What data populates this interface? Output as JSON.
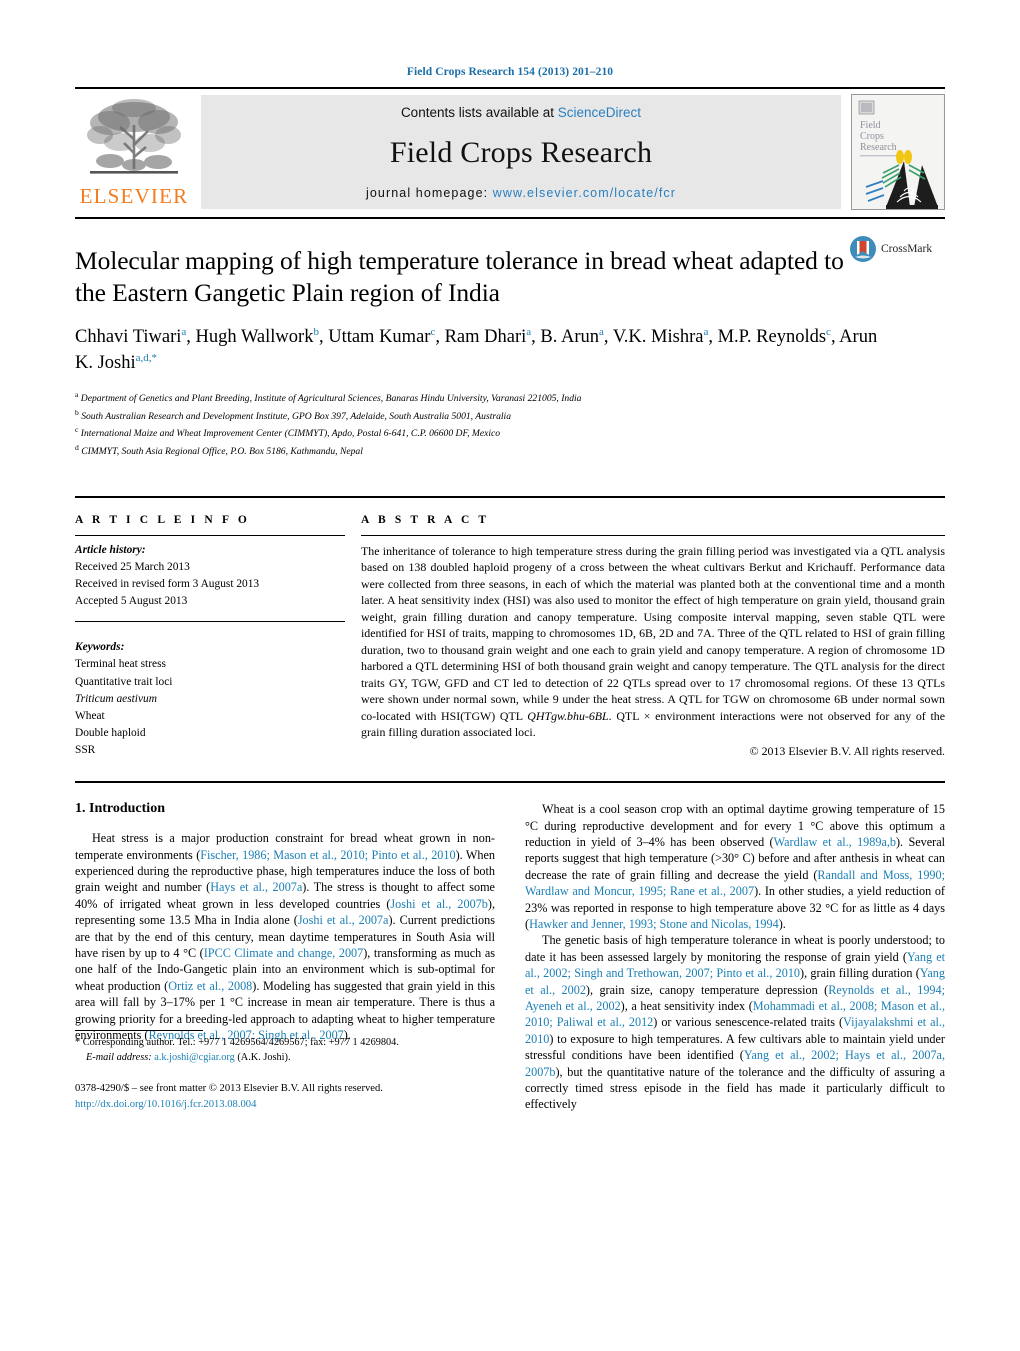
{
  "running_head": "Field Crops Research 154 (2013) 201–210",
  "masthead": {
    "publisher_name": "ELSEVIER",
    "contents_prefix": "Contents lists available at ",
    "contents_link": "ScienceDirect",
    "journal_title": "Field Crops Research",
    "homepage_label": "journal homepage:",
    "homepage_url": "www.elsevier.com/locate/fcr",
    "cover_title_lines": [
      "Field",
      "Crops",
      "Research"
    ]
  },
  "crossmark": {
    "label": "CrossMark"
  },
  "article": {
    "title": "Molecular mapping of high temperature tolerance in bread wheat adapted to the Eastern Gangetic Plain region of India",
    "authors": [
      {
        "name": "Chhavi Tiwari",
        "sup": "a"
      },
      {
        "name": "Hugh Wallwork",
        "sup": "b"
      },
      {
        "name": "Uttam Kumar",
        "sup": "c"
      },
      {
        "name": "Ram Dhari",
        "sup": "a"
      },
      {
        "name": "B. Arun",
        "sup": "a"
      },
      {
        "name": "V.K. Mishra",
        "sup": "a"
      },
      {
        "name": "M.P. Reynolds",
        "sup": "c"
      },
      {
        "name": "Arun K. Joshi",
        "sup": "a,d,*"
      }
    ],
    "affiliations": [
      {
        "mark": "a",
        "text": "Department of Genetics and Plant Breeding, Institute of Agricultural Sciences, Banaras Hindu University, Varanasi 221005, India"
      },
      {
        "mark": "b",
        "text": "South Australian Research and Development Institute, GPO Box 397, Adelaide, South Australia 5001, Australia"
      },
      {
        "mark": "c",
        "text": "International Maize and Wheat Improvement Center (CIMMYT), Apdo, Postal 6-641, C.P. 06600 DF, Mexico"
      },
      {
        "mark": "d",
        "text": "CIMMYT, South Asia Regional Office, P.O. Box 5186, Kathmandu, Nepal"
      }
    ]
  },
  "article_info": {
    "heading": "A R T I C L E   I N F O",
    "history_label": "Article history:",
    "history": [
      "Received 25 March 2013",
      "Received in revised form 3 August 2013",
      "Accepted 5 August 2013"
    ],
    "keywords_label": "Keywords:",
    "keywords": [
      "Terminal heat stress",
      "Quantitative trait loci",
      "Triticum aestivum",
      "Wheat",
      "Double haploid",
      "SSR"
    ],
    "keyword_italic_index": 2
  },
  "abstract": {
    "heading": "A B S T R A C T",
    "text": "The inheritance of tolerance to high temperature stress during the grain filling period was investigated via a QTL analysis based on 138 doubled haploid progeny of a cross between the wheat cultivars Berkut and Krichauff. Performance data were collected from three seasons, in each of which the material was planted both at the conventional time and a month later. A heat sensitivity index (HSI) was also used to monitor the effect of high temperature on grain yield, thousand grain weight, grain filling duration and canopy temperature. Using composite interval mapping, seven stable QTL were identified for HSI of traits, mapping to chromosomes 1D, 6B, 2D and 7A. Three of the QTL related to HSI of grain filling duration, two to thousand grain weight and one each to grain yield and canopy temperature. A region of chromosome 1D harbored a QTL determining HSI of both thousand grain weight and canopy temperature. The QTL analysis for the direct traits GY, TGW, GFD and CT led to detection of 22 QTLs spread over to 17 chromosomal regions. Of these 13 QTLs were shown under normal sown, while 9 under the heat stress. A QTL for TGW on chromosome 6B under normal sown co-located with HSI(TGW) QTL QHTgw.bhu-6BL. QTL × environment interactions were not observed for any of the grain filling duration associated loci.",
    "qtl_italic": "QHTgw.bhu-6BL",
    "copyright": "© 2013 Elsevier B.V. All rights reserved."
  },
  "introduction": {
    "heading": "1.  Introduction",
    "left_paragraphs": [
      {
        "segments": [
          {
            "t": "Heat stress is a major production constraint for bread wheat grown in non-temperate environments (",
            "ref": false
          },
          {
            "t": "Fischer, 1986; Mason et al., 2010; Pinto et al., 2010",
            "ref": true
          },
          {
            "t": "). When experienced during the reproductive phase, high temperatures induce the loss of both grain weight and number (",
            "ref": false
          },
          {
            "t": "Hays et al., 2007a",
            "ref": true
          },
          {
            "t": "). The stress is thought to affect some 40% of irrigated wheat grown in less developed countries (",
            "ref": false
          },
          {
            "t": "Joshi et al., 2007b",
            "ref": true
          },
          {
            "t": "), representing some 13.5 Mha in India alone (",
            "ref": false
          },
          {
            "t": "Joshi et al., 2007a",
            "ref": true
          },
          {
            "t": "). Current predictions are that by the end of this century, mean daytime temperatures in South Asia will have risen by up to 4 °C (",
            "ref": false
          },
          {
            "t": "IPCC Climate and change, 2007",
            "ref": true
          },
          {
            "t": "), transforming as much as one half of the Indo-Gangetic plain into an environment which is sub-optimal for wheat production (",
            "ref": false
          },
          {
            "t": "Ortiz et al., 2008",
            "ref": true
          },
          {
            "t": "). Modeling has suggested that grain yield in this area will fall by 3–17% per 1 °C increase in mean air temperature. There is thus a growing priority for a breeding-led approach to adapting wheat to higher temperature environments (",
            "ref": false
          },
          {
            "t": "Reynolds et al., 2007; Singh et al., 2007",
            "ref": true
          },
          {
            "t": ").",
            "ref": false
          }
        ]
      }
    ],
    "right_paragraphs": [
      {
        "segments": [
          {
            "t": "Wheat is a cool season crop with an optimal daytime growing temperature of 15 °C during reproductive development and for every 1 °C above this optimum a reduction in yield of 3–4% has been observed (",
            "ref": false
          },
          {
            "t": "Wardlaw et al., 1989a,b",
            "ref": true
          },
          {
            "t": "). Several reports suggest that high temperature (>30° C) before and after anthesis in wheat can decrease the rate of grain filling and decrease the yield (",
            "ref": false
          },
          {
            "t": "Randall and Moss, 1990; Wardlaw and Moncur, 1995; Rane et al., 2007",
            "ref": true
          },
          {
            "t": "). In other studies, a yield reduction of 23% was reported in response to high temperature above 32 °C for as little as 4 days (",
            "ref": false
          },
          {
            "t": "Hawker and Jenner, 1993; Stone and Nicolas, 1994",
            "ref": true
          },
          {
            "t": ").",
            "ref": false
          }
        ]
      },
      {
        "segments": [
          {
            "t": "The genetic basis of high temperature tolerance in wheat is poorly understood; to date it has been assessed largely by monitoring the response of grain yield (",
            "ref": false
          },
          {
            "t": "Yang et al., 2002; Singh and Trethowan, 2007; Pinto et al., 2010",
            "ref": true
          },
          {
            "t": "), grain filling duration (",
            "ref": false
          },
          {
            "t": "Yang et al., 2002",
            "ref": true
          },
          {
            "t": "), grain size, canopy temperature depression (",
            "ref": false
          },
          {
            "t": "Reynolds et al., 1994; Ayeneh et al., 2002",
            "ref": true
          },
          {
            "t": "), a heat sensitivity index (",
            "ref": false
          },
          {
            "t": "Mohammadi et al., 2008; Mason et al., 2010; Paliwal et al., 2012",
            "ref": true
          },
          {
            "t": ") or various senescence-related traits (",
            "ref": false
          },
          {
            "t": "Vijayalakshmi et al., 2010",
            "ref": true
          },
          {
            "t": ") to exposure to high temperatures. A few cultivars able to maintain yield under stressful conditions have been identified (",
            "ref": false
          },
          {
            "t": "Yang et al., 2002; Hays et al., 2007a, 2007b",
            "ref": true
          },
          {
            "t": "), but the quantitative nature of the tolerance and the difficulty of assuring a correctly timed stress episode in the field has made it particularly difficult to effectively",
            "ref": false
          }
        ]
      }
    ]
  },
  "footnotes": {
    "corresponding_mark": "*",
    "corresponding_text": "Corresponding author. Tel.: +977 1 4269564/4269567; fax: +977 1 4269804.",
    "email_label": "E-mail address:",
    "email": "a.k.joshi@cgiar.org",
    "email_suffix": "(A.K. Joshi).",
    "issn_line": "0378-4290/$ – see front matter © 2013 Elsevier B.V. All rights reserved.",
    "doi_line": "http://dx.doi.org/10.1016/j.fcr.2013.08.004"
  },
  "colors": {
    "link_blue": "#1b7fb5",
    "header_blue": "#1b6ea8",
    "elsevier_orange": "#f47c20",
    "masthead_grey": "#e7e7e7"
  }
}
